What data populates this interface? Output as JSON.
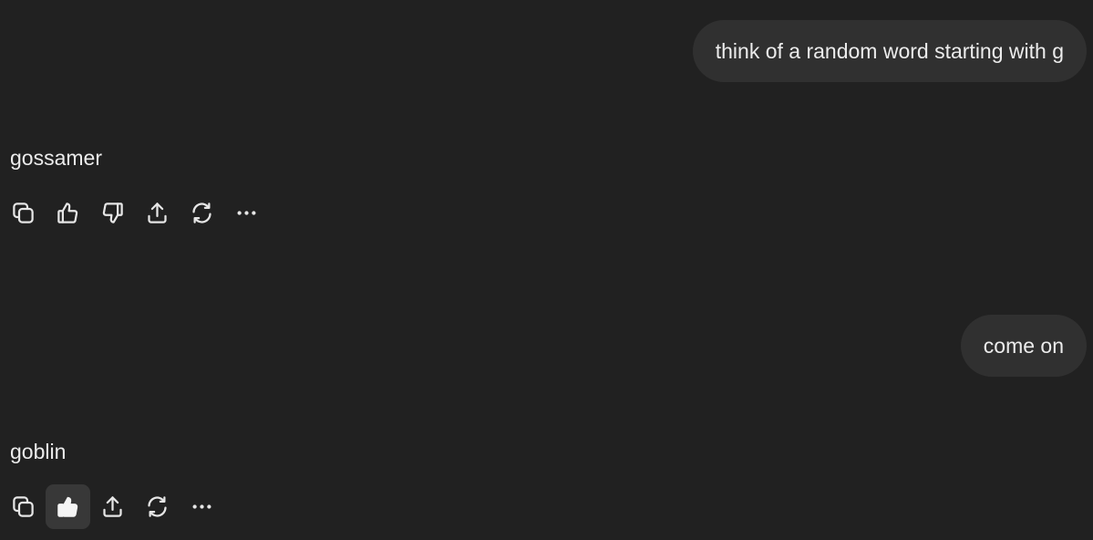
{
  "messages": [
    {
      "role": "user",
      "text": "think of a random word starting with g"
    },
    {
      "role": "assistant",
      "text": "gossamer",
      "actions": [
        "copy-icon",
        "thumbs-up-icon",
        "thumbs-down-icon",
        "share-icon",
        "regenerate-icon",
        "more-icon"
      ]
    },
    {
      "role": "user",
      "text": "come on"
    },
    {
      "role": "assistant",
      "text": "goblin",
      "actions": [
        "copy-icon",
        "thumbs-up-filled-icon",
        "share-icon",
        "regenerate-icon",
        "more-icon"
      ],
      "liked": true
    }
  ],
  "colors": {
    "background": "#212121",
    "user_bubble": "#303030",
    "text": "#ececec",
    "active_action_bg": "#383838"
  }
}
